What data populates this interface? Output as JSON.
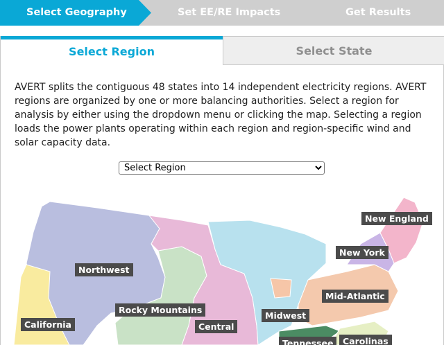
{
  "steps": {
    "items": [
      {
        "label": "Select Geography",
        "active": true
      },
      {
        "label": "Set EE/RE Impacts",
        "active": false
      },
      {
        "label": "Get Results",
        "active": false
      }
    ]
  },
  "tabs": {
    "region": "Select Region",
    "state": "Select State"
  },
  "intro": "AVERT splits the contiguous 48 states into 14 independent electricity regions. AVERT regions are organized by one or more balancing authorities. Select a region for analysis by either using the dropdown menu or clicking the map. Selecting a region loads the power plants operating within each region and region-specific wind and solar capacity data.",
  "region_select": {
    "selected": "Select Region"
  },
  "map_labels": {
    "new_england": "New England",
    "new_york": "New York",
    "northwest": "Northwest",
    "mid_atlantic": "Mid-Atlantic",
    "rocky_mountains": "Rocky Mountains",
    "midwest": "Midwest",
    "central": "Central",
    "california": "California",
    "tennessee": "Tennessee",
    "carolinas": "Carolinas"
  },
  "colors": {
    "accent": "#0aa8d6",
    "step_inactive": "#cfcfcf",
    "label_bg": "#4b4b4b"
  }
}
